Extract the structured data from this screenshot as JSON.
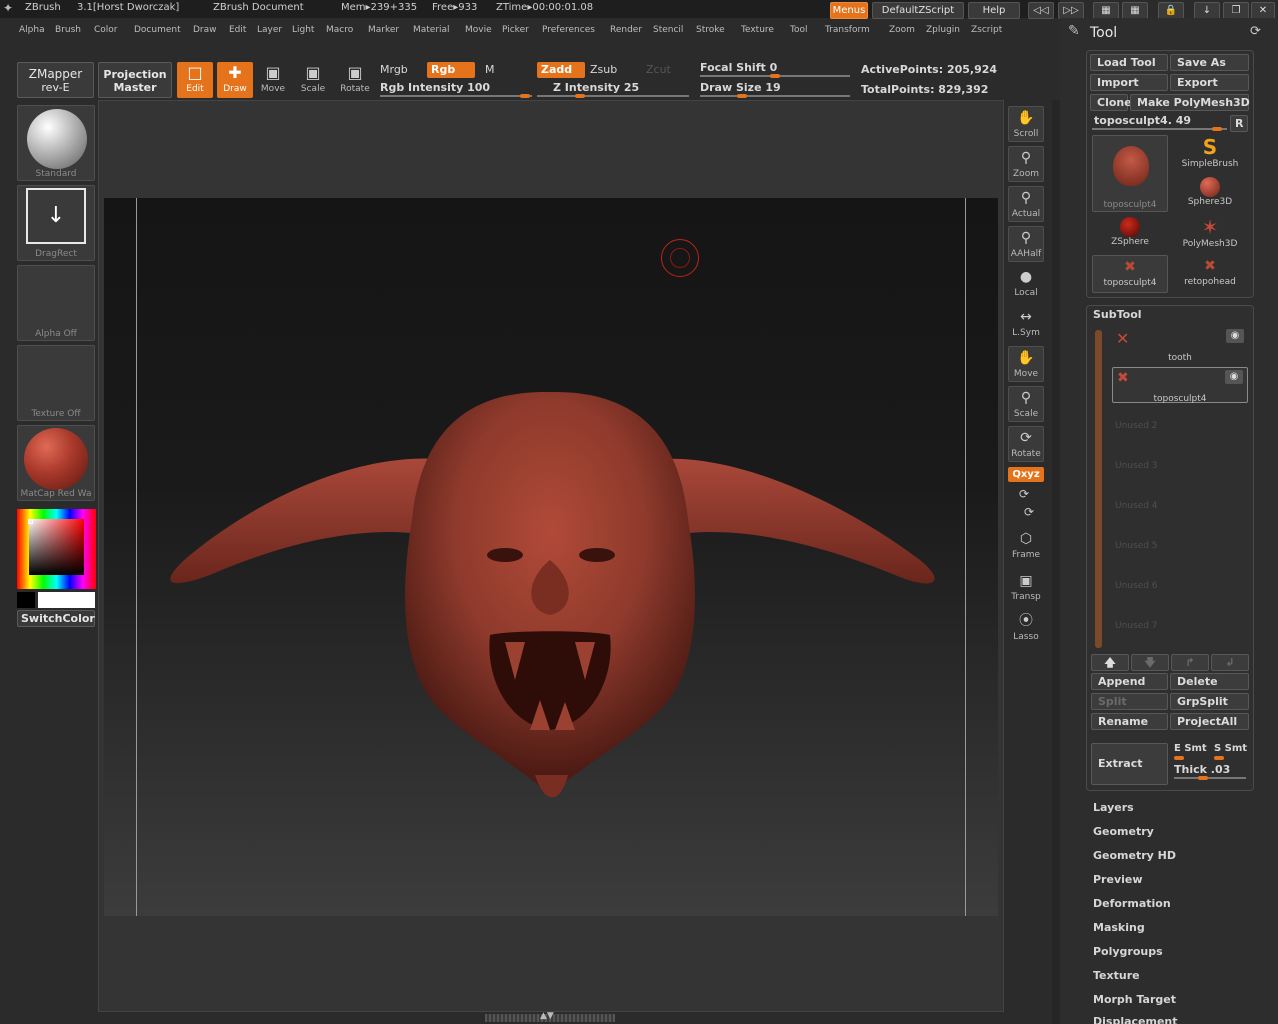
{
  "titlebar": {
    "app_name": "ZBrush",
    "version_user": "3.1[Horst Dworczak]",
    "document": "ZBrush Document",
    "mem": "Mem▸239+335",
    "free": "Free▸933",
    "ztime": "ZTime▸00:00:01.08",
    "menus_label": "Menus",
    "default_zscript": "DefaultZScript",
    "help": "Help"
  },
  "menubar": {
    "items": [
      "Alpha",
      "Brush",
      "Color",
      "Document",
      "Draw",
      "Edit",
      "Layer",
      "Light",
      "Macro",
      "Marker",
      "Material",
      "Movie",
      "Picker",
      "Preferences",
      "Render",
      "Stencil",
      "Stroke",
      "Texture",
      "Tool",
      "Transform",
      "Zoom",
      "Zplugin",
      "Zscript"
    ]
  },
  "toolbar": {
    "zmapper_line1": "ZMapper",
    "zmapper_line2": "rev-E",
    "projection_line1": "Projection",
    "projection_line2": "Master",
    "edit": "Edit",
    "draw": "Draw",
    "move": "Move",
    "scale": "Scale",
    "rotate": "Rotate",
    "mrgb": "Mrgb",
    "rgb": "Rgb",
    "m": "M",
    "rgb_intensity": "Rgb Intensity 100",
    "zadd": "Zadd",
    "zsub": "Zsub",
    "zcut": "Zcut",
    "z_intensity": "Z Intensity 25",
    "focal_shift": "Focal Shift 0",
    "draw_size": "Draw Size 19",
    "active_points": "ActivePoints: 205,924",
    "total_points": "TotalPoints: 829,392"
  },
  "left_shelf": {
    "brush": "Standard",
    "stroke": "DragRect",
    "alpha": "Alpha  Off",
    "texture": "Texture  Off",
    "material": "MatCap  Red  Wa",
    "switch_color": "SwitchColor"
  },
  "right_toolbar": {
    "scroll": "Scroll",
    "zoom": "Zoom",
    "actual": "Actual",
    "aahalf": "AAHalf",
    "local": "Local",
    "lsym": "L.Sym",
    "move": "Move",
    "scale": "Scale",
    "rotate": "Rotate",
    "xyz": "Qxyz",
    "frame": "Frame",
    "transp": "Transp",
    "lasso": "Lasso"
  },
  "tool_panel": {
    "title": "Tool",
    "load_tool": "Load Tool",
    "save_as": "Save As",
    "import": "Import",
    "export": "Export",
    "clone": "Clone",
    "make_polymesh": "Make PolyMesh3D",
    "current_tool": "toposculpt4. 49",
    "r": "R",
    "tools": [
      {
        "name": "toposculpt4"
      },
      {
        "name": "SimpleBrush"
      },
      {
        "name": "Sphere3D"
      },
      {
        "name": "ZSphere"
      },
      {
        "name": "PolyMesh3D"
      },
      {
        "name": "toposculpt4"
      },
      {
        "name": "retopohead"
      }
    ],
    "subtool_header": "SubTool",
    "subtools": [
      "tooth",
      "toposculpt4"
    ],
    "unused": [
      "Unused  2",
      "Unused  3",
      "Unused  4",
      "Unused  5",
      "Unused  6",
      "Unused  7"
    ],
    "append": "Append",
    "delete": "Delete",
    "split": "Split",
    "grpsplit": "GrpSplit",
    "rename": "Rename",
    "projectall": "ProjectAll",
    "extract": "Extract",
    "e_smt": "E  Smt",
    "s_smt": "S  Smt",
    "thick": "Thick  .03",
    "sections": [
      "Layers",
      "Geometry",
      "Geometry  HD",
      "Preview",
      "Deformation",
      "Masking",
      "Polygroups",
      "Texture",
      "Morph Target",
      "Displacement"
    ]
  },
  "colors": {
    "accent": "#e4731b",
    "model": "#8e3a2c",
    "background": "#2b2b2b"
  }
}
